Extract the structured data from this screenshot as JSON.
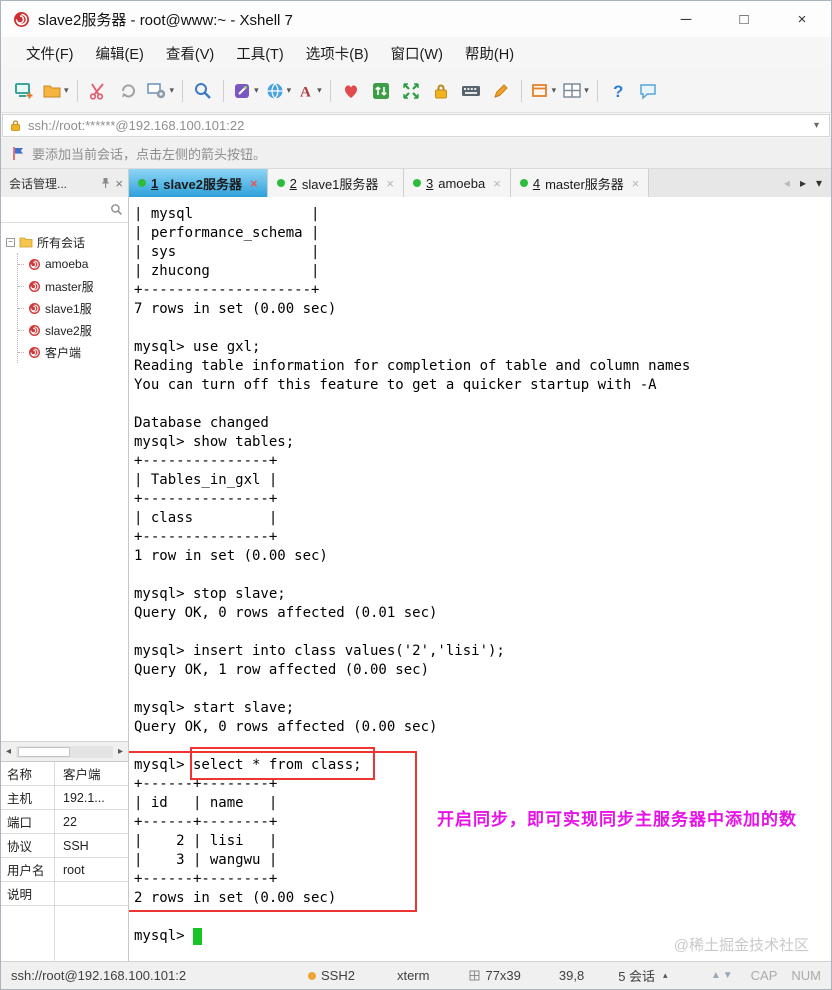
{
  "window": {
    "title": "slave2服务器 - root@www:~ - Xshell 7",
    "controls": {
      "minimize": "─",
      "maximize": "□",
      "close": "×"
    }
  },
  "menu": {
    "items": [
      "文件(F)",
      "编辑(E)",
      "查看(V)",
      "工具(T)",
      "选项卡(B)",
      "窗口(W)",
      "帮助(H)"
    ]
  },
  "toolbar": {
    "icons": [
      "new-session",
      "open-folder",
      "disconnect",
      "reconnect",
      "session-properties",
      "find",
      "compose",
      "web-browser",
      "font",
      "favorites",
      "transfer",
      "fullscreen",
      "lock",
      "virtual-keyboard",
      "highlight-pen",
      "new-window",
      "tile-layout",
      "help",
      "feedback"
    ]
  },
  "address_bar": {
    "value": "ssh://root:******@192.168.100.101:22"
  },
  "info_bar": {
    "text": "要添加当前会话，点击左侧的箭头按钮。"
  },
  "session_pane": {
    "header": "会话管理...",
    "root": "所有会话",
    "sessions": [
      "amoeba",
      "master服",
      "slave1服",
      "slave2服",
      "客户端"
    ],
    "properties": [
      {
        "key": "名称",
        "value": "客户端"
      },
      {
        "key": "主机",
        "value": "192.1..."
      },
      {
        "key": "端口",
        "value": "22"
      },
      {
        "key": "协议",
        "value": "SSH"
      },
      {
        "key": "用户名",
        "value": "root"
      },
      {
        "key": "说明",
        "value": ""
      }
    ]
  },
  "tabs": {
    "items": [
      {
        "num": "1",
        "name": "slave2服务器",
        "active": true
      },
      {
        "num": "2",
        "name": "slave1服务器",
        "active": false
      },
      {
        "num": "3",
        "name": "amoeba",
        "active": false
      },
      {
        "num": "4",
        "name": "master服务器",
        "active": false
      }
    ]
  },
  "icons": {
    "prev_tab": "◂",
    "next_tab": "▸",
    "tab_menu": "▾",
    "tab_close": "×",
    "pane_close": "×",
    "toggle_collapse": "−",
    "scroll_left": "◂",
    "scroll_right": "▸",
    "status_arrows": "▲▼",
    "session_popup": "▴"
  },
  "terminal": {
    "lines": [
      "| mysql              |",
      "| performance_schema |",
      "| sys                |",
      "| zhucong            |",
      "+--------------------+",
      "7 rows in set (0.00 sec)",
      "",
      "mysql> use gxl;",
      "Reading table information for completion of table and column names",
      "You can turn off this feature to get a quicker startup with -A",
      "",
      "Database changed",
      "mysql> show tables;",
      "+---------------+",
      "| Tables_in_gxl |",
      "+---------------+",
      "| class         |",
      "+---------------+",
      "1 row in set (0.00 sec)",
      "",
      "mysql> stop slave;",
      "Query OK, 0 rows affected (0.01 sec)",
      "",
      "mysql> insert into class values('2','lisi');",
      "Query OK, 1 row affected (0.00 sec)",
      "",
      "mysql> start slave;",
      "Query OK, 0 rows affected (0.00 sec)",
      "",
      "mysql> select * from class;",
      "+------+--------+",
      "| id   | name   |",
      "+------+--------+",
      "|    2 | lisi   |",
      "|    3 | wangwu |",
      "+------+--------+",
      "2 rows in set (0.00 sec)",
      "",
      "mysql> "
    ],
    "annotation": "开启同步，即可实现同步主服务器中添加的数",
    "annotation_color": "#e513e5",
    "watermark": "@稀土掘金技术社区"
  },
  "status_bar": {
    "connection": "ssh://root@192.168.100.101:2",
    "protocol": "SSH2",
    "terminal_type": "xterm",
    "size": "77x39",
    "cursor": "39,8",
    "sessions": "5 会话",
    "caps": "CAP",
    "num": "NUM"
  }
}
